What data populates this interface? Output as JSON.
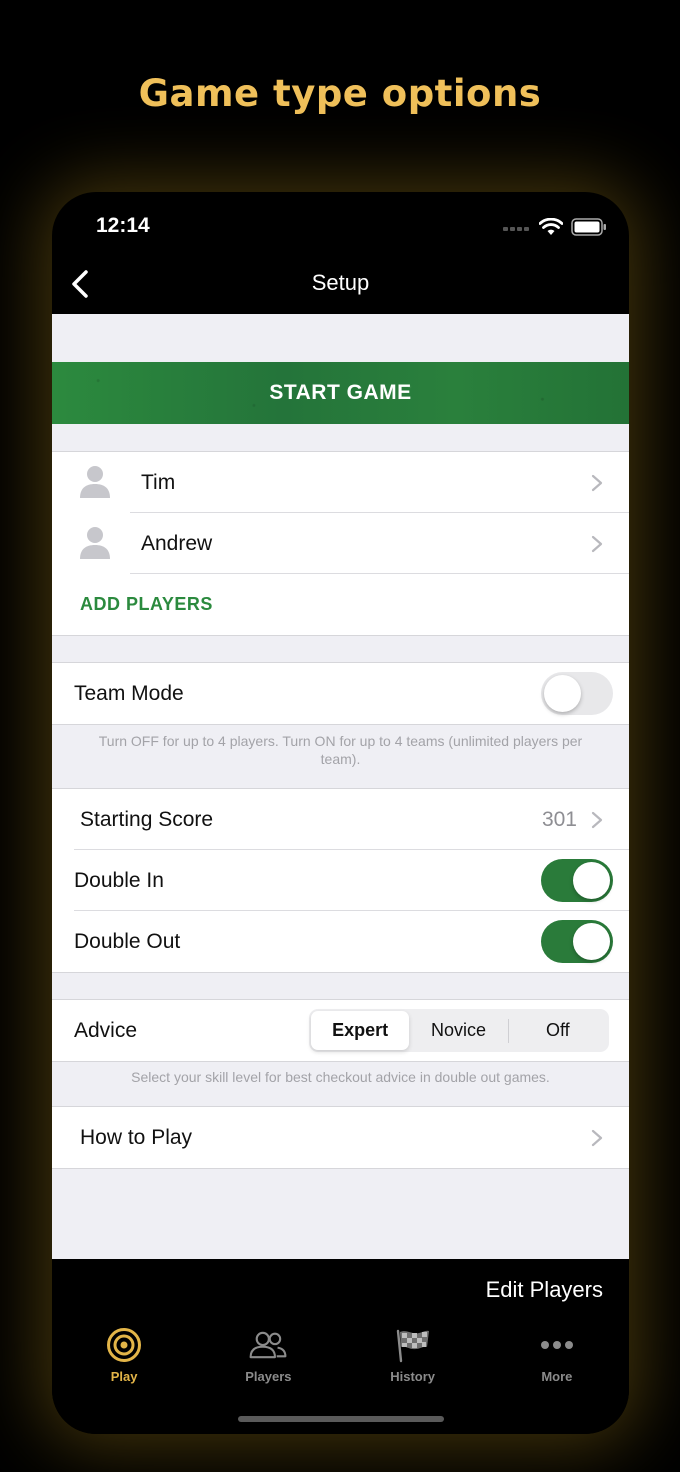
{
  "promo": {
    "title": "Game type options"
  },
  "status_bar": {
    "time": "12:14"
  },
  "nav": {
    "title": "Setup"
  },
  "start_button": {
    "label": "START GAME"
  },
  "players": {
    "list": [
      {
        "name": "Tim"
      },
      {
        "name": "Andrew"
      }
    ],
    "add_label": "ADD PLAYERS"
  },
  "team_mode": {
    "label": "Team Mode",
    "enabled": false,
    "footnote": "Turn OFF for up to 4 players. Turn ON for up to 4 teams (unlimited players per team)."
  },
  "game_options": {
    "starting_score_label": "Starting Score",
    "starting_score_value": "301",
    "double_in_label": "Double In",
    "double_in_enabled": true,
    "double_out_label": "Double Out",
    "double_out_enabled": true
  },
  "advice": {
    "label": "Advice",
    "options": [
      "Expert",
      "Novice",
      "Off"
    ],
    "selected": "Expert",
    "footnote": "Select your skill level for best checkout advice in double out games."
  },
  "how_to_play": {
    "label": "How to Play"
  },
  "toolbar": {
    "edit_players_label": "Edit Players"
  },
  "tabbar": {
    "items": [
      {
        "label": "Play",
        "icon": "target-icon",
        "active": true
      },
      {
        "label": "Players",
        "icon": "people-icon",
        "active": false
      },
      {
        "label": "History",
        "icon": "checkered-flag-icon",
        "active": false
      },
      {
        "label": "More",
        "icon": "ellipsis-icon",
        "active": false
      }
    ]
  },
  "colors": {
    "promo_gold": "#f0c05a",
    "accent_green": "#2a7b3a",
    "tab_active": "#e3b548",
    "tab_inactive": "#8b8b8b"
  }
}
